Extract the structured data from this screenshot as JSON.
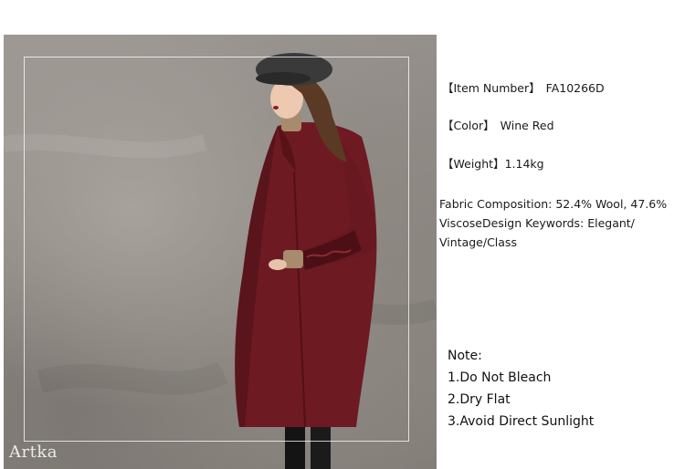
{
  "photo": {
    "brand_logo": "Artka",
    "alt": "Model wearing wine red wool coat"
  },
  "product": {
    "item_number": {
      "label": "【Item Number】",
      "value": "FA10266D"
    },
    "color": {
      "label": "【Color】",
      "value": "Wine Red"
    },
    "weight": {
      "label": "【Weight】",
      "value": "1.14kg"
    },
    "composition_text": "Fabric Composition: 52.4% Wool, 47.6% ViscoseDesign Keywords: Elegant/ Vintage/Class"
  },
  "care": {
    "title": "Note:",
    "items": [
      "1.Do Not Bleach",
      "2.Dry Flat",
      "3.Avoid Direct Sunlight"
    ]
  },
  "colors": {
    "coat": "#6e1a22",
    "background_wall": "#8f8a85",
    "text": "#1a1a1a"
  }
}
